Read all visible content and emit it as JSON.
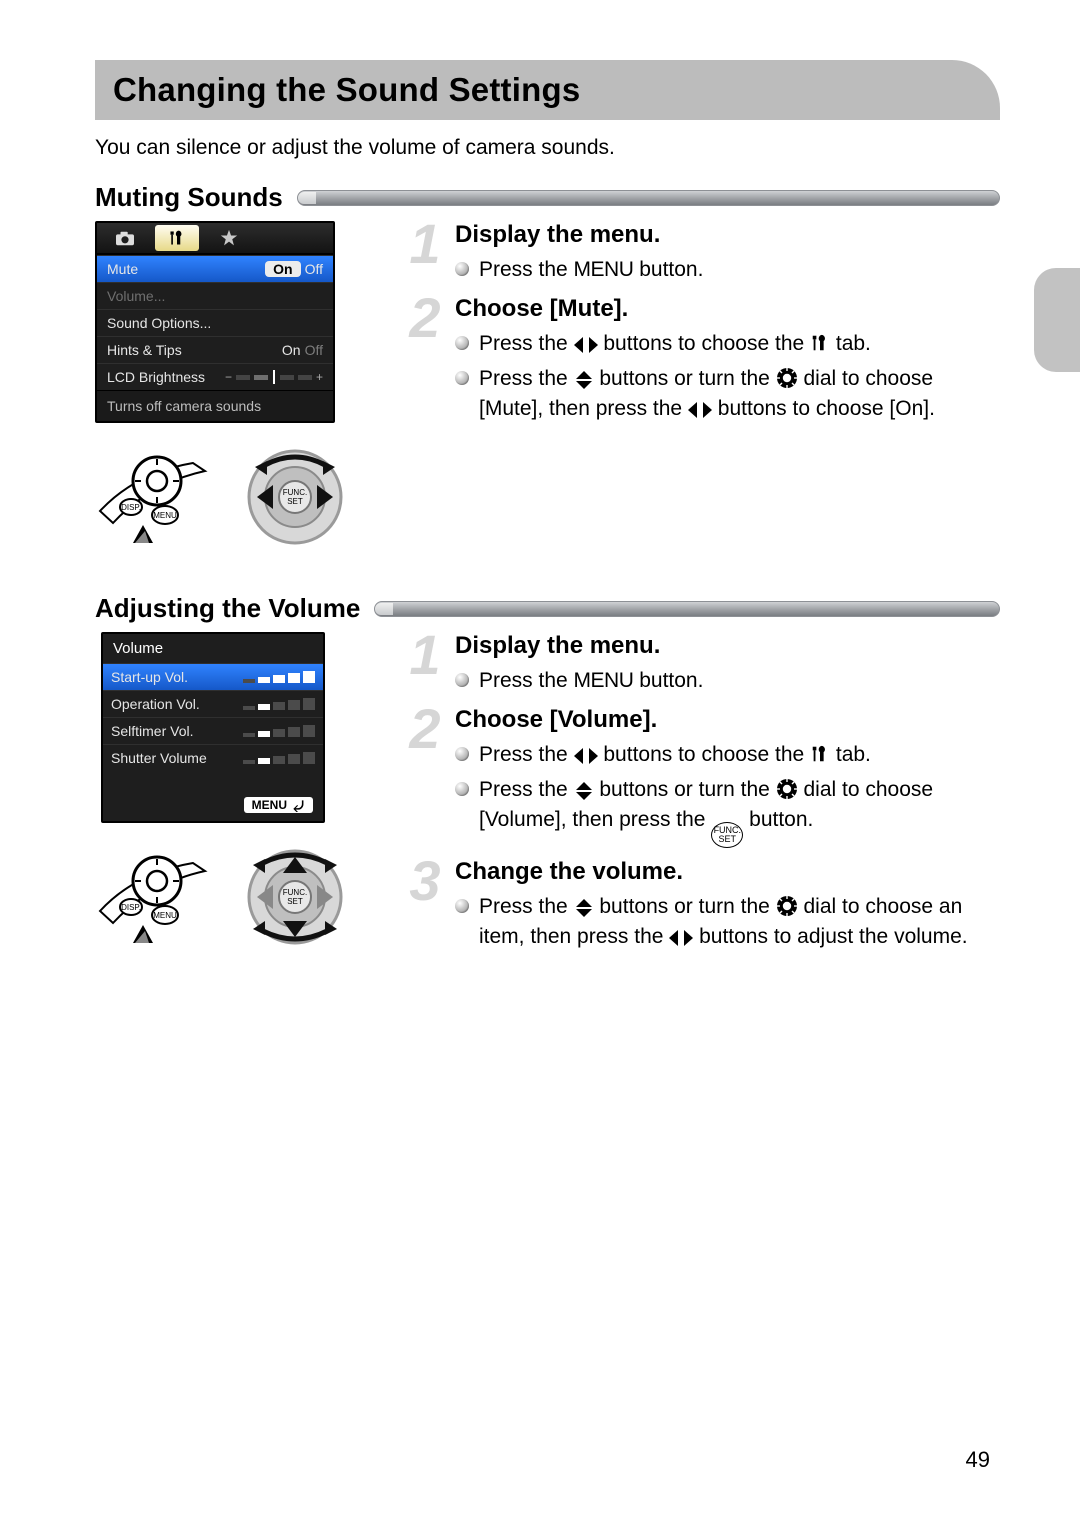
{
  "title": "Changing the Sound Settings",
  "intro": "You can silence or adjust the volume of camera sounds.",
  "page_number": "49",
  "section_mute": {
    "heading": "Muting Sounds",
    "menu": {
      "rows": {
        "mute_label": "Mute",
        "mute_on": "On",
        "mute_off": "Off",
        "volume_label": "Volume...",
        "sound_options_label": "Sound Options...",
        "hints_label": "Hints & Tips",
        "hints_on": "On",
        "hints_off": "Off",
        "lcd_label": "LCD Brightness"
      },
      "help": "Turns off camera sounds"
    },
    "steps": [
      {
        "num": "1",
        "title": "Display the menu.",
        "bullets": [
          {
            "text_before": "Press the ",
            "glyph": "menu",
            "text_after": " button."
          }
        ]
      },
      {
        "num": "2",
        "title": "Choose [Mute].",
        "bullets": [
          {
            "text_before": "Press the ",
            "glyph": "lr",
            "text_mid": " buttons to choose the ",
            "glyph2": "tools",
            "text_after": " tab."
          },
          {
            "text_before": "Press the ",
            "glyph": "ud",
            "text_mid": " buttons or turn the ",
            "glyph2": "dial",
            "text_mid2": " dial to choose [Mute], then press the ",
            "glyph3": "lr",
            "text_after": " buttons to choose [On]."
          }
        ]
      }
    ]
  },
  "section_volume": {
    "heading": "Adjusting the Volume",
    "menu": {
      "title": "Volume",
      "rows": {
        "startup": "Start-up Vol.",
        "operation": "Operation Vol.",
        "selftimer": "Selftimer Vol.",
        "shutter": "Shutter Volume"
      },
      "foot_menu": "MENU"
    },
    "steps": [
      {
        "num": "1",
        "title": "Display the menu.",
        "bullets": [
          {
            "text_before": "Press the ",
            "glyph": "menu",
            "text_after": " button."
          }
        ]
      },
      {
        "num": "2",
        "title": "Choose [Volume].",
        "bullets": [
          {
            "text_before": "Press the ",
            "glyph": "lr",
            "text_mid": " buttons to choose the ",
            "glyph2": "tools",
            "text_after": " tab."
          },
          {
            "text_before": "Press the ",
            "glyph": "ud",
            "text_mid": " buttons or turn the ",
            "glyph2": "dial",
            "text_mid2": " dial to choose [Volume], then press the ",
            "glyph3": "funcset",
            "text_after": " button."
          }
        ]
      },
      {
        "num": "3",
        "title": "Change the volume.",
        "bullets": [
          {
            "text_before": "Press the ",
            "glyph": "ud",
            "text_mid": " buttons or turn the ",
            "glyph2": "dial",
            "text_mid2": " dial to choose an item, then press the ",
            "glyph3": "lr",
            "text_after": " buttons to adjust the volume."
          }
        ]
      }
    ]
  }
}
